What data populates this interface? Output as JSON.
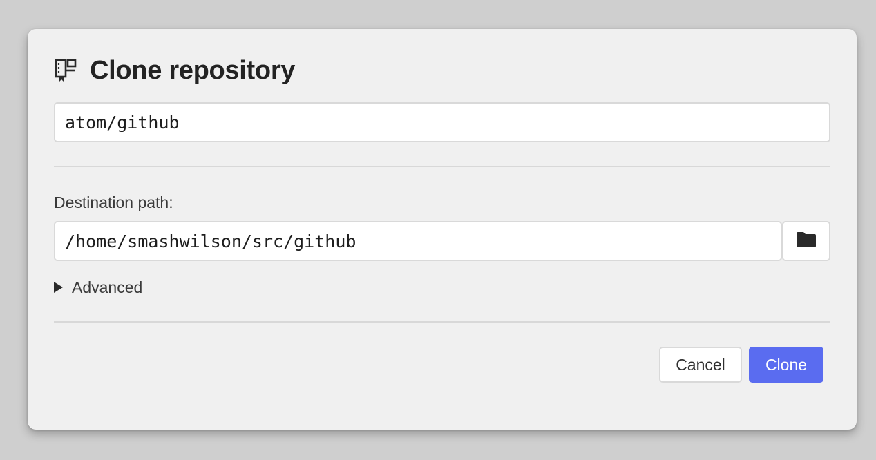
{
  "dialog": {
    "title": "Clone repository",
    "title_icon": "repo-clone-icon",
    "repo_input": {
      "value": "atom/github"
    },
    "destination": {
      "label": "Destination path:",
      "value": "/home/smashwilson/src/github",
      "browse_icon": "folder-icon"
    },
    "advanced": {
      "label": "Advanced",
      "expanded": false,
      "icon": "disclosure-triangle-icon"
    },
    "buttons": {
      "cancel_label": "Cancel",
      "clone_label": "Clone"
    },
    "colors": {
      "accent": "#5a6cf0",
      "background": "#f0f0f0"
    }
  }
}
